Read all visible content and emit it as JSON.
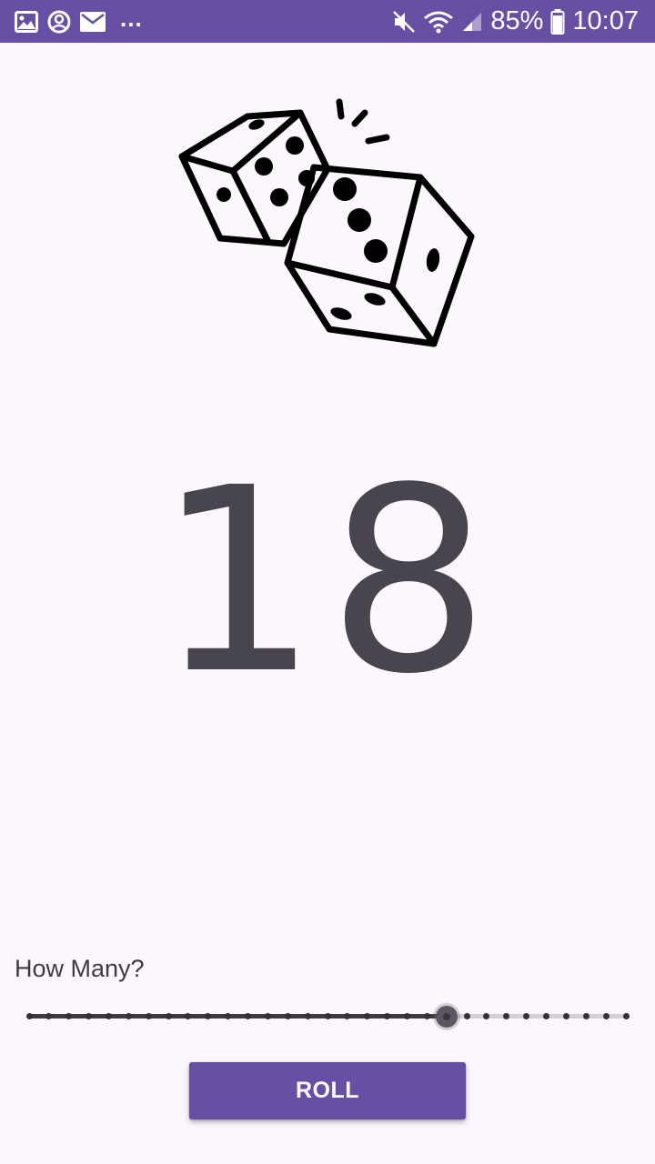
{
  "status_bar": {
    "notification_icons": [
      "gallery-icon",
      "account-circle-icon",
      "mail-icon"
    ],
    "overflow": "...",
    "status_icons": [
      "mute-icon",
      "wifi-icon",
      "signal-icon",
      "battery-icon"
    ],
    "battery": "85%",
    "time": "10:07"
  },
  "hero": {
    "image": "dice-icon"
  },
  "result": {
    "value": "18"
  },
  "dice_count": {
    "label": "How Many?",
    "slider_min": 1,
    "slider_max": 31,
    "slider_value": 22
  },
  "actions": {
    "roll_label": "ROLL"
  },
  "colors": {
    "primary": "#6750a4",
    "background": "#fcf7fc",
    "text": "#49454f"
  }
}
